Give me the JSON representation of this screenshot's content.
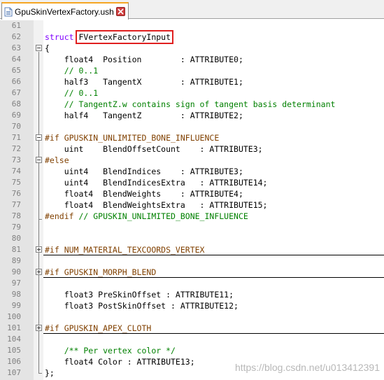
{
  "tab": {
    "title": "GpuSkinVertexFactory.ush",
    "icon": "file-icon",
    "close_icon": "close-icon"
  },
  "lines": [
    {
      "no": "61",
      "segments": []
    },
    {
      "no": "62",
      "segments": [
        {
          "t": "struct ",
          "c": "kw"
        },
        {
          "t": "FVertexFactoryInput",
          "c": "hl"
        }
      ]
    },
    {
      "no": "63",
      "segments": [
        {
          "t": "{",
          "c": ""
        }
      ]
    },
    {
      "no": "64",
      "segments": [
        {
          "t": "    float4  Position        : ATTRIBUTE0;",
          "c": ""
        }
      ]
    },
    {
      "no": "65",
      "segments": [
        {
          "t": "    // 0..1",
          "c": "cm"
        }
      ]
    },
    {
      "no": "66",
      "segments": [
        {
          "t": "    half3   TangentX        : ATTRIBUTE1;",
          "c": ""
        }
      ]
    },
    {
      "no": "67",
      "segments": [
        {
          "t": "    // 0..1",
          "c": "cm"
        }
      ]
    },
    {
      "no": "68",
      "segments": [
        {
          "t": "    // TangentZ.w contains sign of tangent basis determinant",
          "c": "cm"
        }
      ]
    },
    {
      "no": "69",
      "segments": [
        {
          "t": "    half4   TangentZ        : ATTRIBUTE2;",
          "c": ""
        }
      ]
    },
    {
      "no": "70",
      "segments": []
    },
    {
      "no": "71",
      "segments": [
        {
          "t": "#if GPUSKIN_UNLIMITED_BONE_INFLUENCE",
          "c": "pp"
        }
      ]
    },
    {
      "no": "72",
      "segments": [
        {
          "t": "    uint    BlendOffsetCount    : ATTRIBUTE3;",
          "c": ""
        }
      ]
    },
    {
      "no": "73",
      "segments": [
        {
          "t": "#else",
          "c": "pp"
        }
      ]
    },
    {
      "no": "74",
      "segments": [
        {
          "t": "    uint4   BlendIndices    : ATTRIBUTE3;",
          "c": ""
        }
      ]
    },
    {
      "no": "75",
      "segments": [
        {
          "t": "    uint4   BlendIndicesExtra   : ATTRIBUTE14;",
          "c": ""
        }
      ]
    },
    {
      "no": "76",
      "segments": [
        {
          "t": "    float4  BlendWeights    : ATTRIBUTE4;",
          "c": ""
        }
      ]
    },
    {
      "no": "77",
      "segments": [
        {
          "t": "    float4  BlendWeightsExtra   : ATTRIBUTE15;",
          "c": ""
        }
      ]
    },
    {
      "no": "78",
      "segments": [
        {
          "t": "#endif ",
          "c": "pp"
        },
        {
          "t": "// GPUSKIN_UNLIMITED_BONE_INFLUENCE",
          "c": "cm"
        }
      ]
    },
    {
      "no": "79",
      "segments": []
    },
    {
      "no": "80",
      "segments": []
    },
    {
      "no": "81",
      "segments": [
        {
          "t": "#if NUM_MATERIAL_TEXCOORDS_VERTEX",
          "c": "pp"
        }
      ]
    },
    {
      "no": "89",
      "segments": []
    },
    {
      "no": "90",
      "segments": [
        {
          "t": "#if GPUSKIN_MORPH_BLEND",
          "c": "pp"
        }
      ]
    },
    {
      "no": "97",
      "segments": []
    },
    {
      "no": "98",
      "segments": [
        {
          "t": "    float3 PreSkinOffset : ATTRIBUTE11;",
          "c": ""
        }
      ]
    },
    {
      "no": "99",
      "segments": [
        {
          "t": "    float3 PostSkinOffset : ATTRIBUTE12;",
          "c": ""
        }
      ]
    },
    {
      "no": "100",
      "segments": []
    },
    {
      "no": "101",
      "segments": [
        {
          "t": "#if GPUSKIN_APEX_CLOTH",
          "c": "pp"
        }
      ]
    },
    {
      "no": "104",
      "segments": []
    },
    {
      "no": "105",
      "segments": [
        {
          "t": "    /** Per vertex color */",
          "c": "cm"
        }
      ]
    },
    {
      "no": "106",
      "segments": [
        {
          "t": "    float4 Color : ATTRIBUTE13;",
          "c": ""
        }
      ]
    },
    {
      "no": "107",
      "segments": [
        {
          "t": "};",
          "c": ""
        }
      ]
    }
  ],
  "watermark": "https://blog.csdn.net/u013412391",
  "colors": {
    "keyword": "#8000ff",
    "preprocessor": "#804000",
    "comment": "#008000",
    "highlight_border": "#e02020",
    "tab_accent": "#f5a623"
  }
}
